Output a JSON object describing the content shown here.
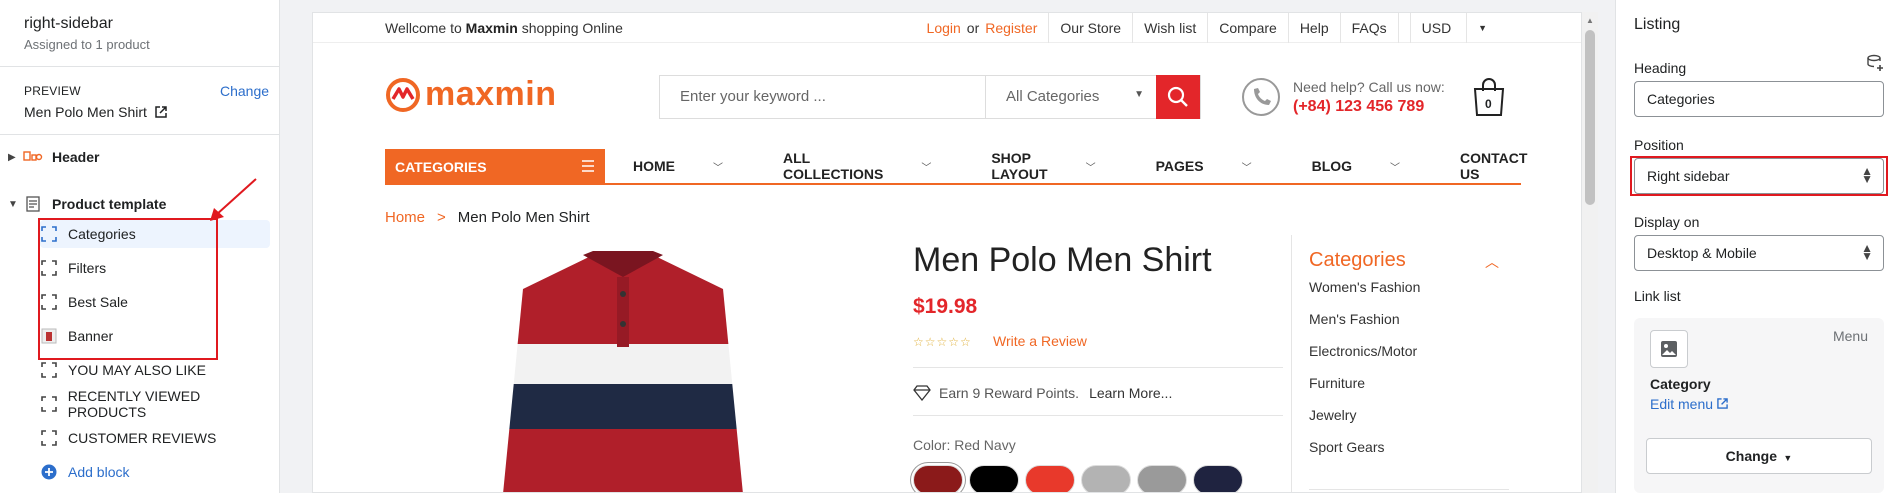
{
  "left_sidebar": {
    "template_name": "right-sidebar",
    "assigned": "Assigned to 1 product",
    "preview_label": "PREVIEW",
    "change_label": "Change",
    "preview_value": "Men Polo Men Shirt",
    "header_label": "Header",
    "product_template_label": "Product template",
    "blocks": [
      {
        "label": "Categories",
        "icon": "block-icon"
      },
      {
        "label": "Filters",
        "icon": "block-icon"
      },
      {
        "label": "Best Sale",
        "icon": "block-icon"
      },
      {
        "label": "Banner",
        "icon": "image-thumb-icon"
      },
      {
        "label": "YOU MAY ALSO LIKE",
        "icon": "block-icon"
      },
      {
        "label": "RECENTLY VIEWED PRODUCTS",
        "icon": "block-icon"
      },
      {
        "label": "CUSTOMER REVIEWS",
        "icon": "block-icon"
      }
    ],
    "add_block_label": "Add block",
    "selected_block": "Categories",
    "annotation_color": "#e0191f"
  },
  "preview": {
    "welcome_prefix": "Wellcome to",
    "welcome_brand": "Maxmin",
    "welcome_suffix": "shopping Online",
    "login": "Login",
    "or": "or",
    "register": "Register",
    "top_links": [
      "Our Store",
      "Wish list",
      "Compare",
      "Help",
      "FAQs"
    ],
    "currency": "USD",
    "logo_text": "maxmin",
    "search_placeholder": "Enter your keyword ...",
    "search_category": "All Categories",
    "help_question": "Need help? Call us now:",
    "help_phone": "(+84) 123 456 789",
    "cart_count": "0",
    "categories_button": "CATEGORIES",
    "menu": [
      "HOME",
      "ALL COLLECTIONS",
      "SHOP LAYOUT",
      "PAGES",
      "BLOG",
      "CONTACT US"
    ],
    "breadcrumb_home": "Home",
    "breadcrumb_current": "Men Polo Men Shirt",
    "product_title": "Men Polo Men Shirt",
    "price": "$19.98",
    "rating_stars": "☆☆☆☆☆",
    "write_review": "Write a Review",
    "reward_text": "Earn 9 Reward Points.",
    "learn_more": "Learn More...",
    "color_label": "Color: Red Navy",
    "swatches": [
      "#8b1a1a",
      "#000000",
      "#e8392b",
      "#b3b3b3",
      "#9a9a9a",
      "#1f2340"
    ],
    "sidebar_title": "Categories",
    "sidebar_items": [
      "Women's Fashion",
      "Men's Fashion",
      "Electronics/Motor",
      "Furniture",
      "Jewelry",
      "Sport Gears"
    ],
    "accent": "#f06724",
    "price_color": "#e3262a"
  },
  "right_panel": {
    "title": "Listing",
    "heading_label": "Heading",
    "heading_value": "Categories",
    "position_label": "Position",
    "position_value": "Right sidebar",
    "display_label": "Display on",
    "display_value": "Desktop & Mobile",
    "link_list_label": "Link list",
    "menu_label": "Menu",
    "link_name": "Category",
    "edit_menu": "Edit menu",
    "change_button": "Change"
  }
}
